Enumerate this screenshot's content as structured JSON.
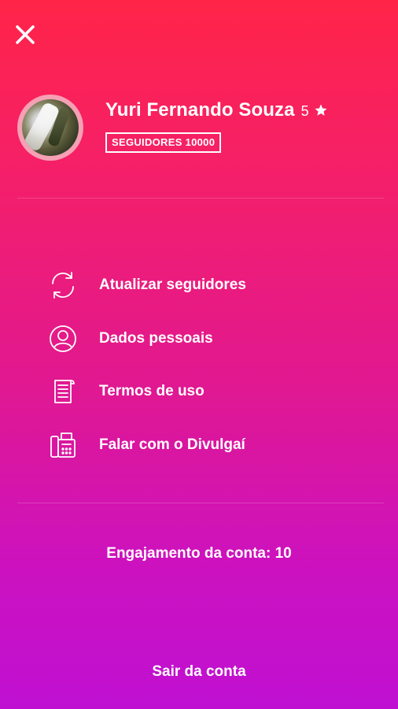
{
  "header": {
    "close_icon": "close-icon"
  },
  "profile": {
    "name": "Yuri Fernando Souza",
    "rating": "5",
    "rating_icon": "star-icon",
    "followers_badge": "SEGUIDORES 10000"
  },
  "menu": {
    "items": [
      {
        "label": "Atualizar seguidores",
        "icon": "refresh-icon"
      },
      {
        "label": "Dados pessoais",
        "icon": "user-circle-icon"
      },
      {
        "label": "Termos de uso",
        "icon": "document-icon"
      },
      {
        "label": "Falar com o Divulgaí",
        "icon": "phone-fax-icon"
      }
    ]
  },
  "engagement": "Engajamento da conta: 10",
  "logout_label": "Sair da conta",
  "colors": {
    "gradient_top": "#ff2448",
    "gradient_bottom": "#bf10d2",
    "text": "#ffffff"
  }
}
